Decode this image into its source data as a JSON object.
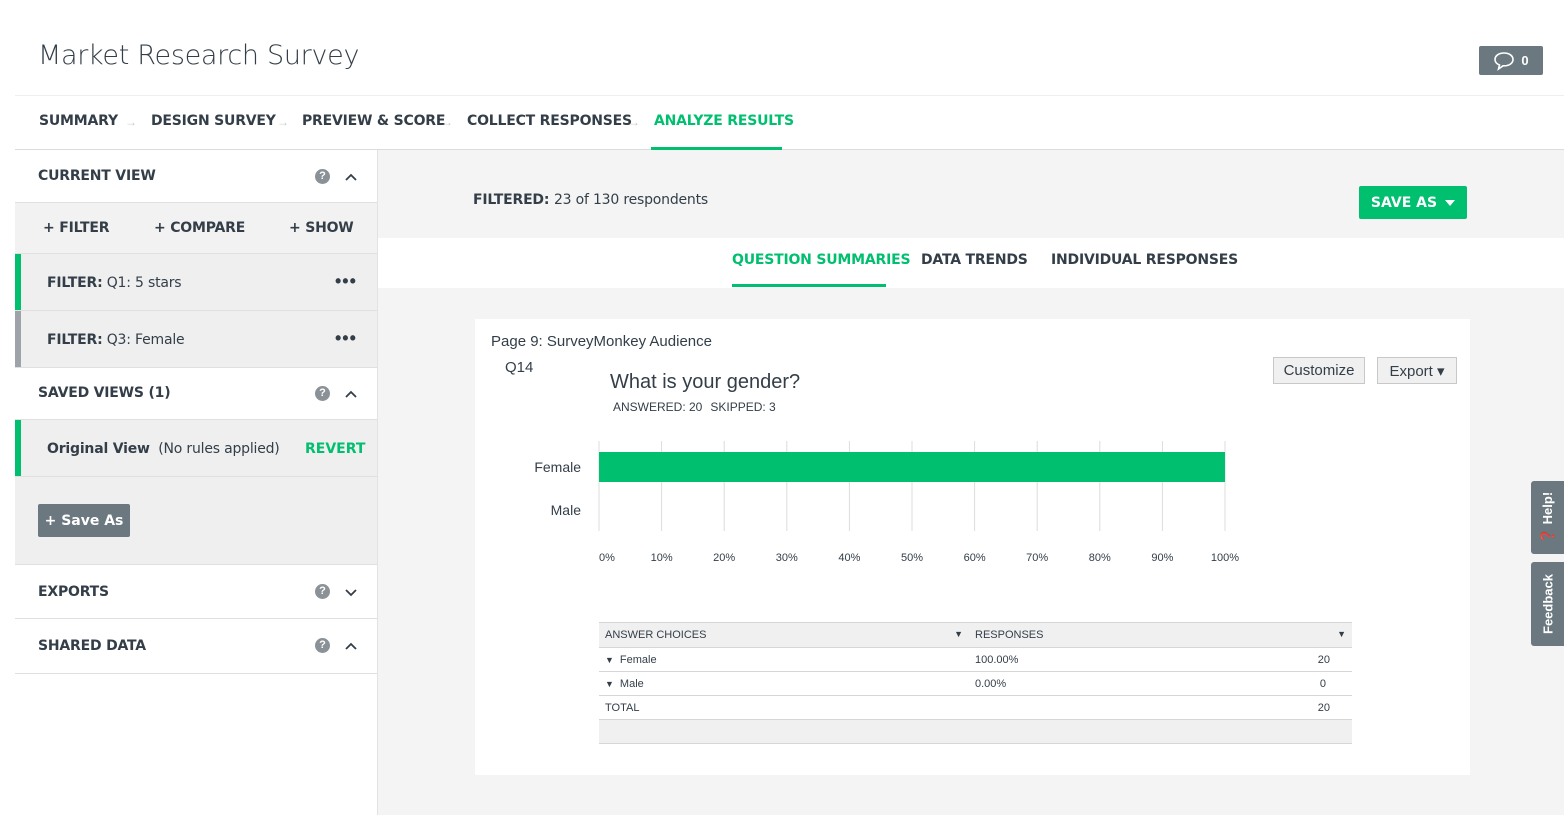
{
  "header": {
    "title": "Market Research Survey",
    "comment_count": "0"
  },
  "steps": [
    {
      "label": "SUMMARY"
    },
    {
      "label": "DESIGN SURVEY"
    },
    {
      "label": "PREVIEW & SCORE"
    },
    {
      "label": "COLLECT RESPONSES"
    },
    {
      "label": "ANALYZE RESULTS",
      "active": true
    }
  ],
  "sidebar": {
    "current_view": "CURRENT VIEW",
    "help": "?",
    "actions": {
      "filter": "+ FILTER",
      "compare": "+ COMPARE",
      "show": "+ SHOW"
    },
    "filters": [
      {
        "prefix": "FILTER:",
        "text": "Q1: 5 stars",
        "stripe": "#00bf6f"
      },
      {
        "prefix": "FILTER:",
        "text": "Q3: Female",
        "stripe": "#9da3a8"
      }
    ],
    "more": "•••",
    "saved_views": "SAVED VIEWS (1)",
    "original_view": {
      "name": "Original View",
      "note": "(No rules applied)",
      "action": "REVERT"
    },
    "save_as": "+ Save As",
    "exports": "EXPORTS",
    "shared_data": "SHARED DATA"
  },
  "main": {
    "filtered_label": "FILTERED:",
    "filtered_value": "23 of 130 respondents",
    "save_as": "SAVE AS",
    "tabs": [
      {
        "label": "QUESTION SUMMARIES",
        "active": true
      },
      {
        "label": "DATA TRENDS"
      },
      {
        "label": "INDIVIDUAL RESPONSES"
      }
    ]
  },
  "question": {
    "page": "Page 9: SurveyMonkey Audience",
    "number": "Q14",
    "title": "What is your gender?",
    "answered": "ANSWERED: 20",
    "skipped": "SKIPPED: 3",
    "customize": "Customize",
    "export": "Export ▾"
  },
  "chart_data": {
    "type": "bar",
    "orientation": "horizontal",
    "categories": [
      "Female",
      "Male"
    ],
    "values": [
      100,
      0
    ],
    "x_ticks": [
      "0%",
      "10%",
      "20%",
      "30%",
      "40%",
      "50%",
      "60%",
      "70%",
      "80%",
      "90%",
      "100%"
    ],
    "xlim": [
      0,
      100
    ],
    "bar_color": "#00bf6f",
    "grid": true
  },
  "answers": {
    "col_choice": "ANSWER CHOICES",
    "col_responses": "RESPONSES",
    "rows": [
      {
        "choice": "Female",
        "pct": "100.00%",
        "count": "20"
      },
      {
        "choice": "Male",
        "pct": "0.00%",
        "count": "0"
      }
    ],
    "total_label": "TOTAL",
    "total_count": "20"
  },
  "side_tabs": {
    "help": "Help!",
    "feedback": "Feedback"
  },
  "colors": {
    "accent": "#00bf6f",
    "dark_button": "#6b787f",
    "text": "#333e48"
  }
}
